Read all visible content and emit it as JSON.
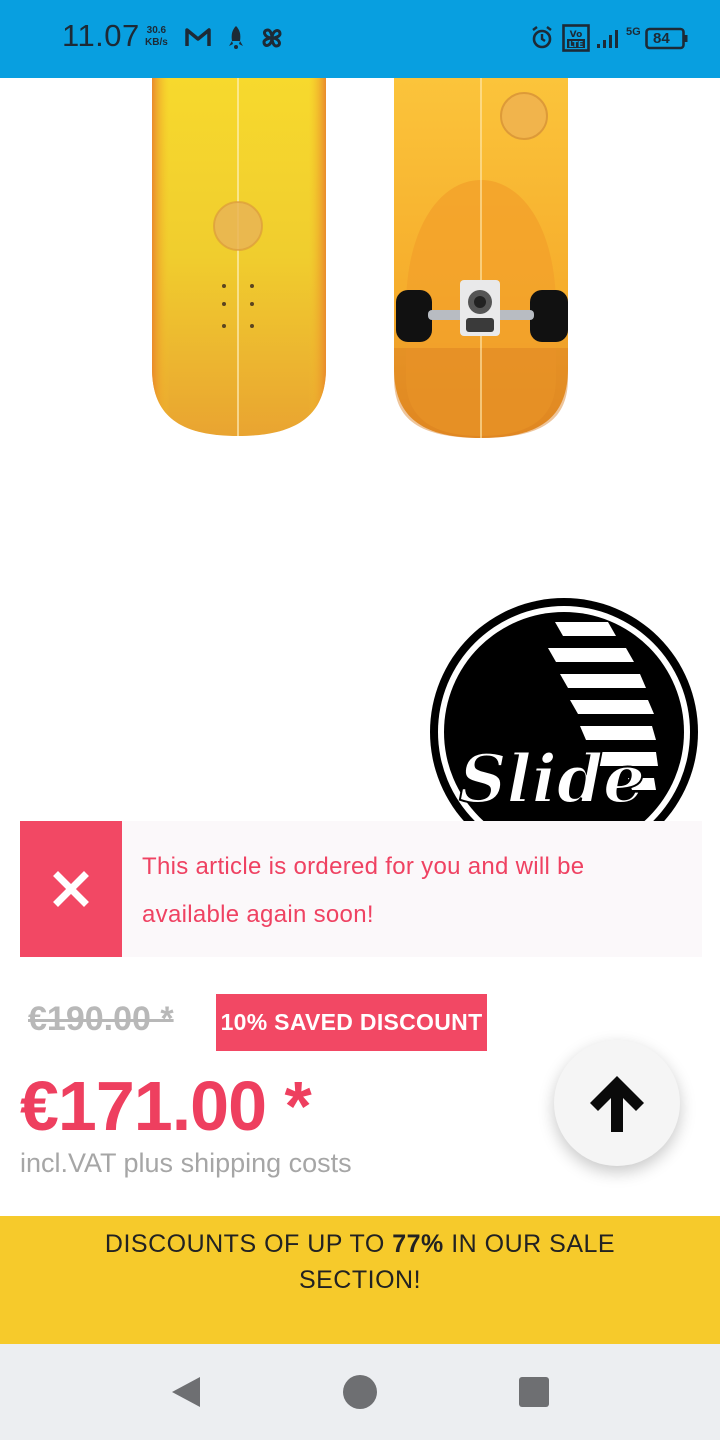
{
  "status_bar": {
    "time": "11.07",
    "net_speed_value": "30.6",
    "net_speed_unit": "KB/s",
    "network": "5G",
    "battery": "84",
    "icons": [
      "gmail-icon",
      "rocket-icon",
      "pinwheel-icon",
      "alarm-icon",
      "volte-icon",
      "signal-icon",
      "battery-icon"
    ],
    "color": "#089fe0"
  },
  "product": {
    "images": [
      "skateboard-top-view",
      "skateboard-bottom-view"
    ],
    "brand_logo_text": "Slide"
  },
  "notice": {
    "text": "This article is ordered for you and will be available again soon!",
    "accent": "#f24864"
  },
  "price": {
    "old": "€190.00 *",
    "discount": "10% SAVED DISCOUNT",
    "current": "€171.00 *",
    "note": "incl.VAT plus shipping costs"
  },
  "promo": {
    "prefix": "DISCOUNTS OF UP TO ",
    "highlight": "77%",
    "suffix": " IN OUR SALE SECTION!",
    "color": "#f6ca2b"
  },
  "nav": {
    "buttons": [
      "back-icon",
      "home-icon",
      "recents-icon"
    ]
  }
}
